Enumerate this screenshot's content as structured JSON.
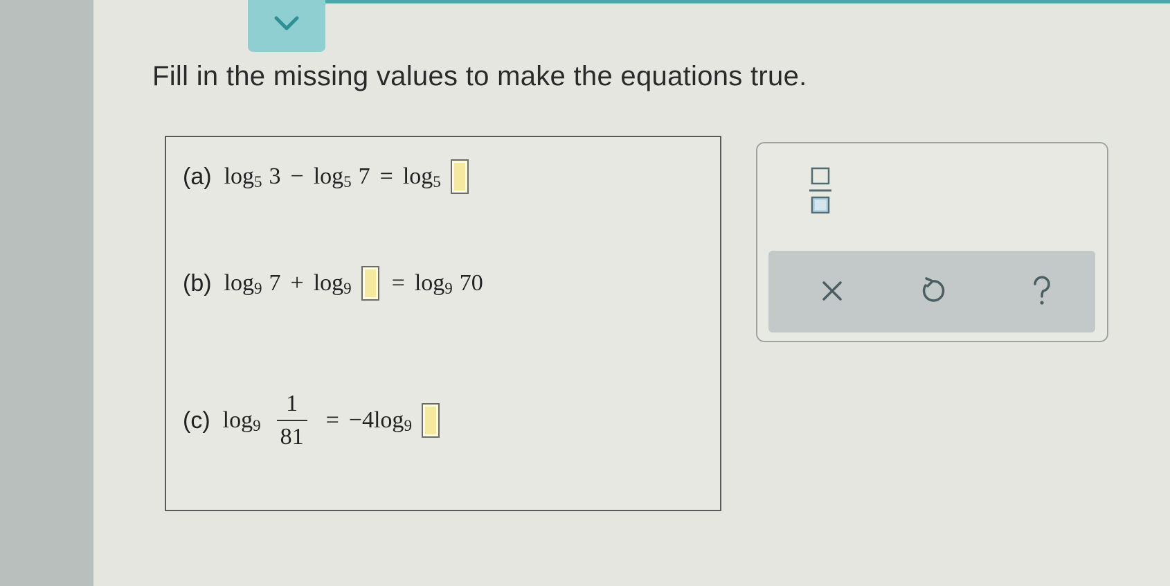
{
  "instruction": "Fill in the missing values to make the equations true.",
  "equations": {
    "a": {
      "label": "(a)",
      "log1": "log",
      "base1": "5",
      "arg1": "3",
      "op1": "−",
      "log2": "log",
      "base2": "5",
      "arg2": "7",
      "eq": "=",
      "log3": "log",
      "base3": "5"
    },
    "b": {
      "label": "(b)",
      "log1": "log",
      "base1": "9",
      "arg1": "7",
      "op1": "+",
      "log2": "log",
      "base2": "9",
      "eq": "=",
      "log3": "log",
      "base3": "9",
      "arg3": "70"
    },
    "c": {
      "label": "(c)",
      "log1": "log",
      "base1": "9",
      "frac_num": "1",
      "frac_den": "81",
      "eq": "=",
      "coef": "−4",
      "log2": "log",
      "base2": "9"
    }
  },
  "tools": {
    "fraction_icon": "fraction-template-icon",
    "clear_icon": "x-icon",
    "undo_icon": "undo-icon",
    "help_icon": "question-mark-icon"
  },
  "colors": {
    "accent": "#8fcfd2",
    "answer_box_fill": "#f5e9a0"
  }
}
